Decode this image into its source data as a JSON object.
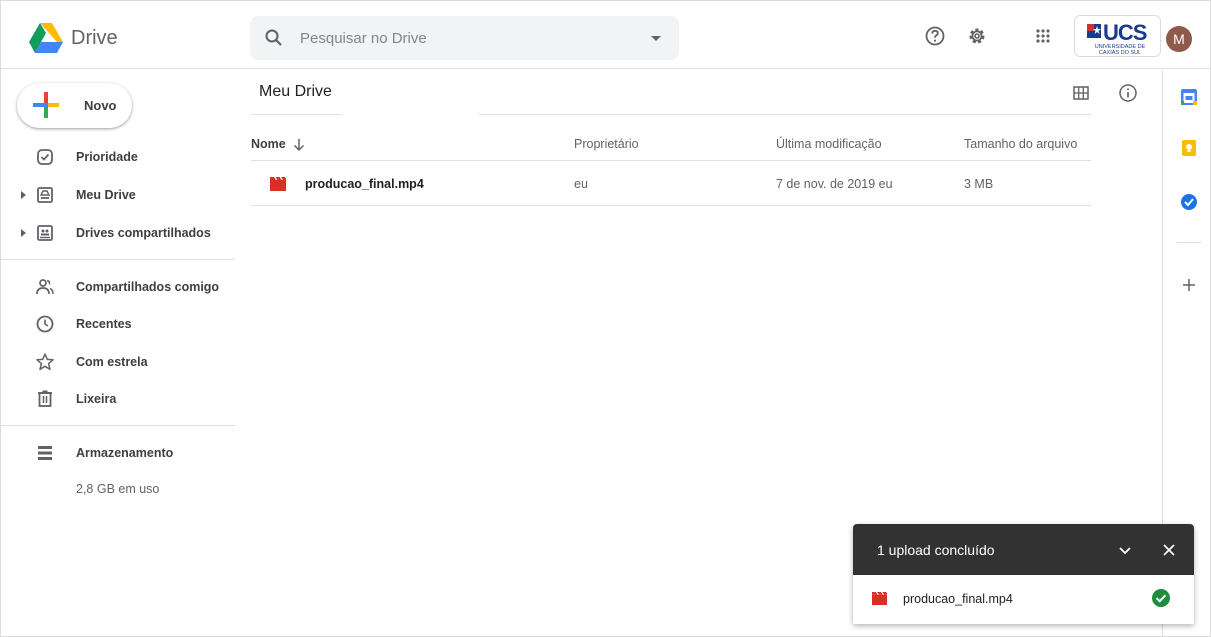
{
  "header": {
    "app_title": "Drive",
    "search_placeholder": "Pesquisar no Drive",
    "institution": {
      "main": "UCS",
      "sub": "UNIVERSIDADE DE CAXIAS DO SUL"
    },
    "avatar_initial": "M",
    "icons": [
      "help-icon",
      "settings-icon",
      "apps-grid-icon"
    ]
  },
  "sidebar": {
    "new_label": "Novo",
    "items": [
      {
        "label": "Prioridade",
        "icon": "priority-icon"
      },
      {
        "label": "Meu Drive",
        "icon": "my-drive-icon",
        "expandable": true
      },
      {
        "label": "Drives compartilhados",
        "icon": "shared-drives-icon",
        "expandable": true
      },
      {
        "label": "Compartilhados comigo",
        "icon": "shared-with-me-icon"
      },
      {
        "label": "Recentes",
        "icon": "clock-icon"
      },
      {
        "label": "Com estrela",
        "icon": "star-icon"
      },
      {
        "label": "Lixeira",
        "icon": "trash-icon"
      },
      {
        "label": "Armazenamento",
        "icon": "storage-icon"
      }
    ],
    "storage_used": "2,8 GB em uso"
  },
  "main": {
    "title": "Meu Drive",
    "columns": [
      "Nome",
      "Proprietário",
      "Última modificação",
      "Tamanho do arquivo"
    ],
    "rows": [
      {
        "name": "producao_final.mp4",
        "owner": "eu",
        "modified": "7 de nov. de 2019 eu",
        "size": "3 MB"
      }
    ]
  },
  "upload_panel": {
    "title": "1 upload concluído",
    "file": "producao_final.mp4"
  },
  "colors": {
    "video_red": "#d93025",
    "check_green": "#1e8e3e",
    "panel_dark": "#323232"
  }
}
